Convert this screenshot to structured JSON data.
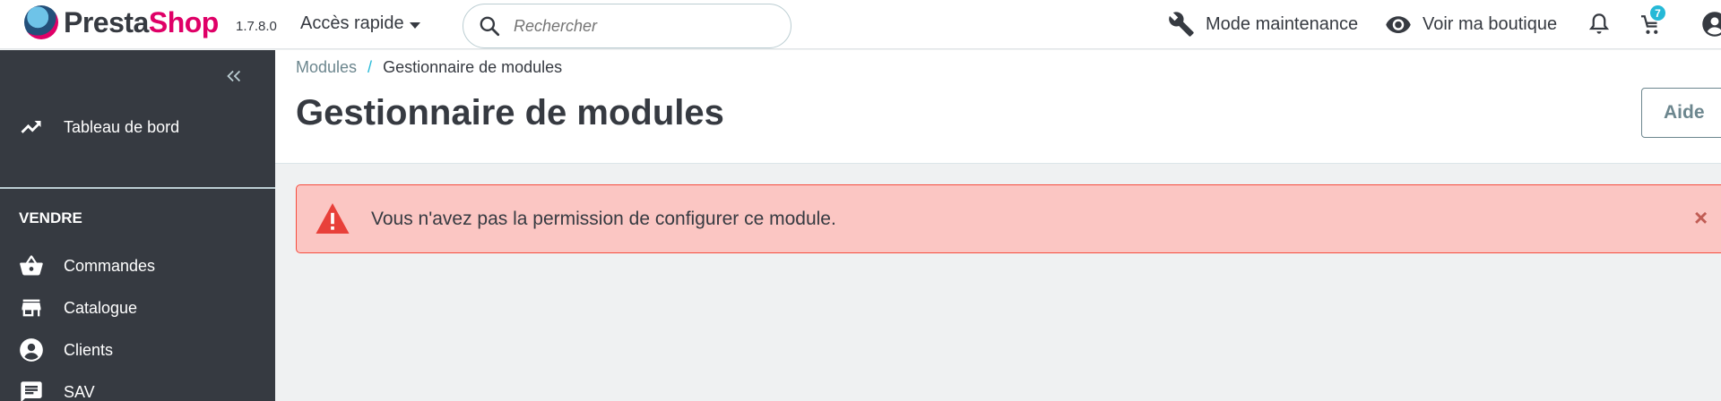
{
  "header": {
    "logo_part1": "Presta",
    "logo_part2": "Shop",
    "version": "1.7.8.0",
    "quick_access": "Accès rapide",
    "search_placeholder": "Rechercher",
    "maintenance": "Mode maintenance",
    "view_shop": "Voir ma boutique",
    "orders_badge": "7"
  },
  "sidebar": {
    "dashboard": "Tableau de bord",
    "section_sell": "VENDRE",
    "items": [
      {
        "label": "Commandes",
        "icon": "basket-icon"
      },
      {
        "label": "Catalogue",
        "icon": "store-icon"
      },
      {
        "label": "Clients",
        "icon": "account-circle-icon"
      },
      {
        "label": "SAV",
        "icon": "chat-icon"
      }
    ]
  },
  "breadcrumb": {
    "parent": "Modules",
    "separator": "/",
    "current": "Gestionnaire de modules"
  },
  "page_title": "Gestionnaire de modules",
  "help_button": "Aide",
  "alert": {
    "message": "Vous n'avez pas la permission de configurer ce module.",
    "close": "×"
  },
  "colors": {
    "brand_pink": "#df0067",
    "sidebar_bg": "#363a41",
    "accent": "#25b9d7",
    "alert_bg": "#fbc6c3",
    "alert_border": "#f54c3e",
    "alert_icon": "#e8403a"
  }
}
